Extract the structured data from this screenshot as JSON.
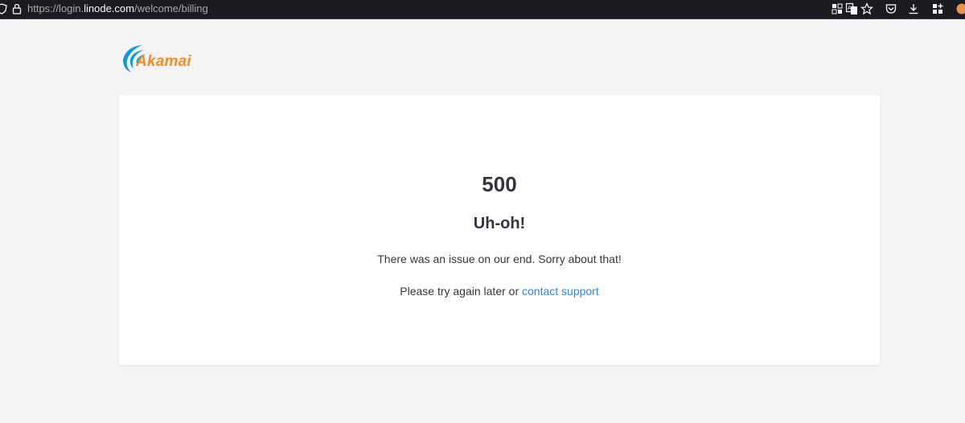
{
  "browser": {
    "url_prefix": "https://login.",
    "url_domain": "linode.com",
    "url_path": "/welcome/billing",
    "icons": [
      "shield-icon",
      "lock-icon",
      "extensions-grid-icon",
      "translate-icon",
      "bookmark-star-icon",
      "pocket-icon",
      "download-icon",
      "apps-icon",
      "profile-icon"
    ]
  },
  "brand": {
    "logo_text": "Akamai",
    "logo_color": "#f28c28",
    "wave_color": "#0a9ae2"
  },
  "error": {
    "code": "500",
    "title": "Uh-oh!",
    "message": "There was an issue on our end. Sorry about that!",
    "help_prefix": "Please try again later or ",
    "help_link": "contact support"
  },
  "colors": {
    "page_background": "#f4f4f4",
    "card_background": "#ffffff",
    "link": "#3683dc",
    "toolbar": "#1c1b22"
  }
}
